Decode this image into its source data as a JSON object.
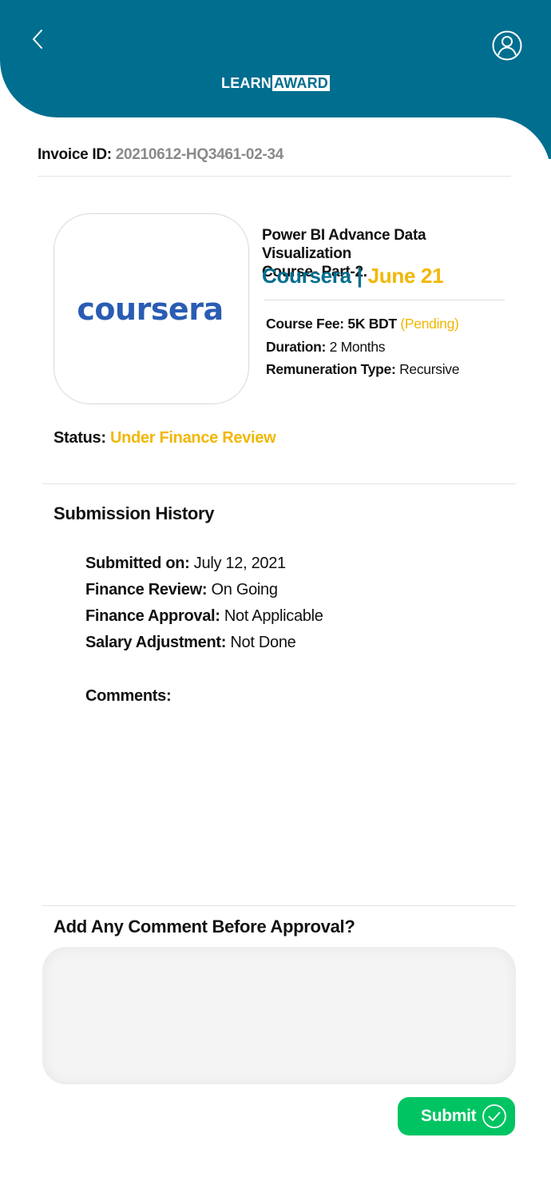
{
  "header": {
    "logo_learn": "LEARN",
    "logo_award": "AWARD",
    "back_icon": "chevron-left-icon",
    "profile_icon": "user-circle-icon",
    "color": "#006e8f"
  },
  "invoice": {
    "label": "Invoice ID:",
    "value": "20210612-HQ3461-02-34"
  },
  "course": {
    "provider_logo_text": "coursera",
    "title_line1": "Power BI Advance Data Visualization",
    "title_line2": "Course- Part-2.",
    "provider": "Coursera",
    "separator": "|",
    "date": "June 21",
    "fee_label": "Course Fee:",
    "fee_value": "5K BDT",
    "fee_status": "(Pending)",
    "duration_label": "Duration:",
    "duration_value": "2 Months",
    "remuneration_label": "Remuneration Type:",
    "remuneration_value": "Recursive"
  },
  "status": {
    "label": "Status:",
    "value": "Under Finance Review",
    "color": "#f2b705"
  },
  "history": {
    "title": "Submission History",
    "items": [
      {
        "label": "Submitted on:",
        "value": "July 12, 2021"
      },
      {
        "label": "Finance Review:",
        "value": "On Going"
      },
      {
        "label": "Finance Approval:",
        "value": "Not Applicable"
      },
      {
        "label": "Salary Adjustment:",
        "value": "Not Done"
      }
    ],
    "comments_label": "Comments:"
  },
  "approval": {
    "title": "Add Any Comment Before Approval?",
    "comment_value": "",
    "submit_label": "Submit",
    "submit_icon": "check-circle-icon",
    "submit_color": "#00c462"
  }
}
